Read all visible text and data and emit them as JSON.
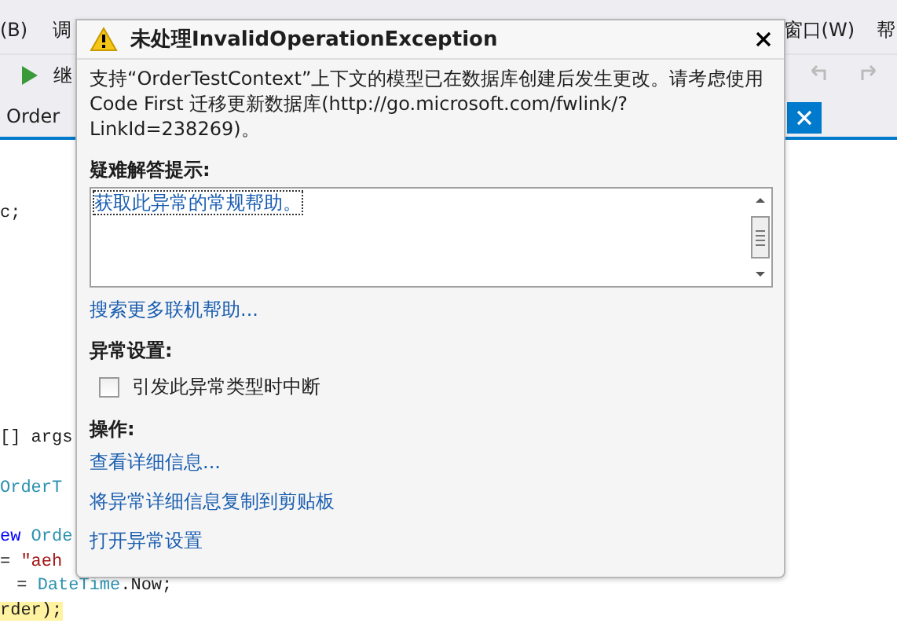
{
  "ide": {
    "menu": [
      {
        "label": "(B)"
      },
      {
        "label": "调"
      },
      {
        "label": "窗口(W)"
      },
      {
        "label": "帮"
      }
    ],
    "toolbar": {
      "continue_label": "继"
    },
    "tab": {
      "label": "Order"
    },
    "code_lines": [
      {
        "segments": [
          {
            "kind": "plain",
            "text": "c;"
          }
        ]
      },
      {
        "segments": [
          {
            "kind": "plain",
            "text": "[] args"
          }
        ]
      },
      {
        "segments": [
          {
            "kind": "type",
            "text": "OrderT"
          }
        ]
      },
      {
        "segments": [
          {
            "kind": "keyword",
            "text": "ew"
          },
          {
            "kind": "type",
            "text": "Orde"
          }
        ]
      },
      {
        "segments": [
          {
            "kind": "plain",
            "text": "="
          },
          {
            "kind": "string",
            "text": "\"aeh"
          }
        ]
      },
      {
        "segments": [
          {
            "kind": "plain",
            "text": " = "
          },
          {
            "kind": "type",
            "text": "DateTime"
          },
          {
            "kind": "plain",
            "text": ".Now;"
          }
        ]
      },
      {
        "segments": [
          {
            "kind": "highlight",
            "text": "rder);"
          }
        ]
      }
    ]
  },
  "dialog": {
    "title": "未处理InvalidOperationException",
    "message": "支持“OrderTestContext”上下文的模型已在数据库创建后发生更改。请考虑使用 Code First 迁移更新数据库(http://go.microsoft.com/fwlink/?LinkId=238269)。",
    "hints_heading": "疑难解答提示:",
    "hints": [
      {
        "text": "获取此异常的常规帮助。",
        "selected": true
      }
    ],
    "search_link": "搜索更多联机帮助...",
    "settings_heading": "异常设置:",
    "break_option": {
      "label": "引发此异常类型时中断",
      "checked": false
    },
    "actions_heading": "操作:",
    "actions": [
      "查看详细信息...",
      "将异常详细信息复制到剪贴板",
      "打开异常设置"
    ]
  }
}
